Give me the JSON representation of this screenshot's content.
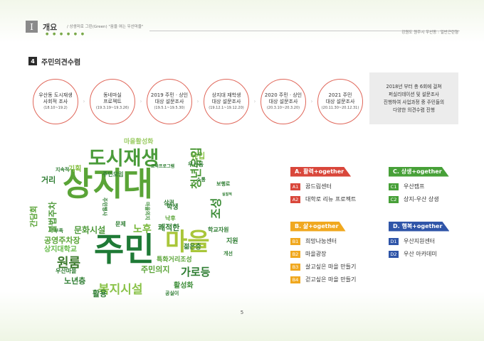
{
  "header": {
    "section_roman": "I",
    "title": "개요",
    "subtitle": "/ 상생미로 그린(Green) \"꿈을 여는 우산마을\"",
    "dots": "● ● ● ● ● ●",
    "right_text": "강원도 원주시 우산동 : 일반근린형"
  },
  "section": {
    "number": "4",
    "title": "주민의견수렴"
  },
  "timeline": [
    {
      "line1": "우산동 도시재생",
      "line2": "사회적 조사",
      "dates": "(18.10~19.2)"
    },
    {
      "line1": "동네마실",
      "line2": "프로젝트",
      "dates": "(19.3.19~19.3.26)"
    },
    {
      "line1": "2019 주민ㆍ상인",
      "line2": "대상 설문조사",
      "dates": "(19.5.1~19.5.30)"
    },
    {
      "line1": "상지대 재학생",
      "line2": "대상 설문조사",
      "dates": "(19.12.1~19.12.20)"
    },
    {
      "line1": "2020 주민ㆍ상인",
      "line2": "대상 설문조사",
      "dates": "(20.3.10~20.3.20)"
    },
    {
      "line1": "2021 주민",
      "line2": "대상 설문조사",
      "dates": "(20.11.30~20.12.31)"
    }
  ],
  "timeline_arrow": "›",
  "summary": [
    "2018년 부터 총 6회에 걸쳐",
    "퍼실리테이션 및 설문조사",
    "진행하여 사업과정 중 주민들의",
    "다양한 의견수렴 진행"
  ],
  "word_cloud": [
    {
      "text": "주민",
      "color": "#1f7a36"
    },
    {
      "text": "상지대",
      "color": "#5aa437"
    },
    {
      "text": "마을",
      "color": "#a9c63a"
    },
    {
      "text": "도시재생",
      "color": "#4a9b3a"
    },
    {
      "text": "복지시설",
      "color": "#8bc34a"
    },
    {
      "text": "문화시설",
      "color": "#4f9a3b"
    },
    {
      "text": "노후",
      "color": "#79b83b"
    },
    {
      "text": "가로등",
      "color": "#2e7d32"
    },
    {
      "text": "활용",
      "color": "#2e7d32"
    },
    {
      "text": "활성화",
      "color": "#3f8e3a"
    },
    {
      "text": "원룸",
      "color": "#3d7a2e"
    },
    {
      "text": "노년층",
      "color": "#2e7d32"
    },
    {
      "text": "공영주차장",
      "color": "#5aa437"
    },
    {
      "text": "상지대학교",
      "color": "#66bb4a"
    },
    {
      "text": "주민의지",
      "color": "#5aa437"
    },
    {
      "text": "쾌적한",
      "color": "#2e7d32"
    },
    {
      "text": "마을활성화",
      "color": "#9ccc65"
    },
    {
      "text": "주민모임",
      "color": "#2e7d32"
    },
    {
      "text": "거리",
      "color": "#2e7d32"
    },
    {
      "text": "기획",
      "color": "#8bc34a"
    },
    {
      "text": "지속적",
      "color": "#2e7d32"
    },
    {
      "text": "상권",
      "color": "#2e7d32"
    },
    {
      "text": "학생",
      "color": "#2e7d32"
    },
    {
      "text": "지원",
      "color": "#2e7d32"
    },
    {
      "text": "유입",
      "color": "#8bc34a"
    },
    {
      "text": "청년유입",
      "color": "#4f9a3b"
    },
    {
      "text": "조성",
      "color": "#3f8e3a"
    },
    {
      "text": "특화거리조성",
      "color": "#5aa437"
    },
    {
      "text": "우산동",
      "color": "#2e7d32"
    },
    {
      "text": "교육프로그램",
      "color": "#2e7d32"
    },
    {
      "text": "부족",
      "color": "#2e7d32"
    },
    {
      "text": "우산마을",
      "color": "#2e7d32"
    },
    {
      "text": "젊은층",
      "color": "#2e7d32"
    },
    {
      "text": "학교자원",
      "color": "#2e7d32"
    },
    {
      "text": "보행로",
      "color": "#2e7d32"
    },
    {
      "text": "문제",
      "color": "#2e7d32"
    },
    {
      "text": "공실이",
      "color": "#2e7d32"
    },
    {
      "text": "불법주차",
      "color": "#4f9a3b"
    },
    {
      "text": "간담회",
      "color": "#5aa437"
    },
    {
      "text": "개선",
      "color": "#2e7d32"
    },
    {
      "text": "소통",
      "color": "#2e7d32"
    },
    {
      "text": "마을의지",
      "color": "#3f8e3a"
    },
    {
      "text": "주민행사",
      "color": "#2e7d32"
    },
    {
      "text": "낙후",
      "color": "#5aa437"
    },
    {
      "text": "실질적",
      "color": "#2e7d32"
    }
  ],
  "categories": [
    {
      "header": "A. 활력+ogether",
      "color": "#d9473b",
      "items": [
        {
          "code": "A1",
          "label": "꿈드림센터"
        },
        {
          "code": "A2",
          "label": "대학로 리뉴 프로젝트"
        }
      ]
    },
    {
      "header": "B. 삶+ogether",
      "color": "#f0a81f",
      "items": [
        {
          "code": "B1",
          "label": "희망나눔센터"
        },
        {
          "code": "B2",
          "label": "마을광장"
        },
        {
          "code": "B3",
          "label": "살고싶은 마을 만들기"
        },
        {
          "code": "B4",
          "label": "걷고싶은 마을 만들기"
        }
      ]
    },
    {
      "header": "C. 상생+ogether",
      "color": "#47a038",
      "items": [
        {
          "code": "C1",
          "label": "우산캠프"
        },
        {
          "code": "C2",
          "label": "상지-우산 상생"
        }
      ]
    },
    {
      "header": "D. 행복+ogether",
      "color": "#2f55a8",
      "items": [
        {
          "code": "D1",
          "label": "우산지원센터"
        },
        {
          "code": "D2",
          "label": "우산 아카데미"
        }
      ]
    }
  ],
  "page_number": "5"
}
